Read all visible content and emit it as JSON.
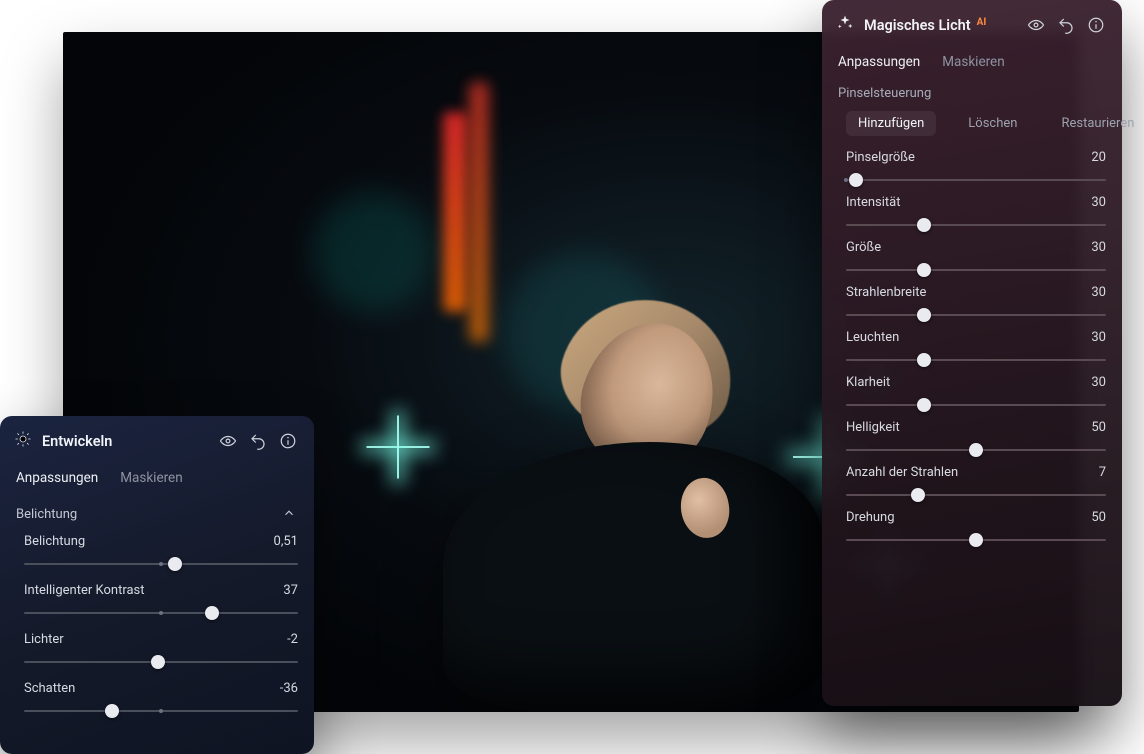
{
  "photo": {
    "description": "Night city portrait with light flares"
  },
  "develop_panel": {
    "title": "Entwickeln",
    "tabs": {
      "adjust": "Anpassungen",
      "mask": "Maskieren",
      "active": "adjust"
    },
    "group": "Belichtung",
    "sliders": [
      {
        "id": "exposure",
        "label": "Belichtung",
        "value_text": "0,51",
        "min": -5,
        "max": 5,
        "value": 0.51,
        "tick_at": 0
      },
      {
        "id": "contrast",
        "label": "Intelligenter Kontrast",
        "value_text": "37",
        "min": -100,
        "max": 100,
        "value": 37,
        "tick_at": 0
      },
      {
        "id": "highlights",
        "label": "Lichter",
        "value_text": "-2",
        "min": -100,
        "max": 100,
        "value": -2,
        "tick_at": 0
      },
      {
        "id": "shadows",
        "label": "Schatten",
        "value_text": "-36",
        "min": -100,
        "max": 100,
        "value": -36,
        "tick_at": 0
      }
    ]
  },
  "magic_panel": {
    "title": "Magisches Licht",
    "ai_badge": "AI",
    "tabs": {
      "adjust": "Anpassungen",
      "mask": "Maskieren",
      "active": "adjust"
    },
    "section": "Pinselsteuerung",
    "segmented": {
      "add": "Hinzufügen",
      "erase": "Löschen",
      "restore": "Restaurieren",
      "active": "add"
    },
    "sliders": [
      {
        "id": "brush_size",
        "label": "Pinselgröße",
        "value_text": "20",
        "min": 1,
        "max": 500,
        "value": 20,
        "tick_at": 1
      },
      {
        "id": "intensity",
        "label": "Intensität",
        "value_text": "30",
        "min": 0,
        "max": 100,
        "value": 30,
        "tick_at": null
      },
      {
        "id": "size",
        "label": "Größe",
        "value_text": "30",
        "min": 0,
        "max": 100,
        "value": 30,
        "tick_at": null
      },
      {
        "id": "ray_width",
        "label": "Strahlenbreite",
        "value_text": "30",
        "min": 0,
        "max": 100,
        "value": 30,
        "tick_at": null
      },
      {
        "id": "glow",
        "label": "Leuchten",
        "value_text": "30",
        "min": 0,
        "max": 100,
        "value": 30,
        "tick_at": null
      },
      {
        "id": "clarity",
        "label": "Klarheit",
        "value_text": "30",
        "min": 0,
        "max": 100,
        "value": 30,
        "tick_at": null
      },
      {
        "id": "brightness",
        "label": "Helligkeit",
        "value_text": "50",
        "min": 0,
        "max": 100,
        "value": 50,
        "tick_at": null
      },
      {
        "id": "ray_count",
        "label": "Anzahl der Strahlen",
        "value_text": "7",
        "min": 2,
        "max": 20,
        "value": 7,
        "tick_at": null
      },
      {
        "id": "rotation",
        "label": "Drehung",
        "value_text": "50",
        "min": 0,
        "max": 100,
        "value": 50,
        "tick_at": null
      }
    ]
  },
  "icons": {
    "visibility": "eye-icon",
    "undo": "undo-icon",
    "info": "info-icon",
    "sparkle": "sparkle-icon",
    "develop": "brightness-icon",
    "collapse": "chevron-up-icon"
  }
}
